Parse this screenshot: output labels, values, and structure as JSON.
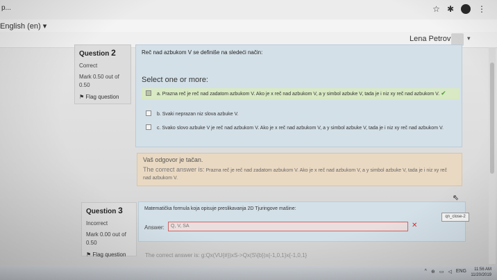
{
  "browser": {
    "tab_fragment": "p...",
    "icons": [
      "star-icon",
      "extension-icon",
      "profile-icon",
      "menu-icon"
    ]
  },
  "nav": {
    "language": "English (en)"
  },
  "user": {
    "name": "Lena Petrovic"
  },
  "question2": {
    "label": "Question",
    "number": "2",
    "state": "Correct",
    "mark_line1": "Mark 0.50 out of",
    "mark_line2": "0.50",
    "flag": "Flag question",
    "text": "Reč nad azbukom V se definiše na sledeći način:",
    "prompt": "Select one or more:",
    "options": [
      {
        "letter": "a.",
        "text": "Prazna reč je reč nad zadatom azbukom V. Ako je x reč nad azbukom V, a y simbol azbuke V, tada je i niz xy reč nad azbukom V.",
        "checked": true
      },
      {
        "letter": "b.",
        "text": "Svaki neprazan niz slova azbuke V.",
        "checked": false
      },
      {
        "letter": "c.",
        "text": "Svako slovo azbuke V je reč nad azbukom V. Ako je x reč nad azbukom V, a y simbol azbuke V, tada je i niz xy reč nad azbukom V.",
        "checked": false
      }
    ],
    "feedback": "Vaš odgovor je tačan.",
    "correct_answer_label": "The correct answer is:",
    "correct_answer": "Prazna reč je reč nad zadatom azbukom V. Ako je x reč nad azbukom V, a y simbol azbuke V, tada je i niz xy reč nad azbukom V."
  },
  "question3": {
    "label": "Question",
    "number": "3",
    "state": "Incorrect",
    "mark_line1": "Mark 0.00 out of",
    "mark_line2": "0.50",
    "flag": "Flag question",
    "text": "Matematička formula koja opisuje preslikavanja 2D Tjuringove mašine:",
    "answer_label": "Answer:",
    "answer_value": "Q, V, SA",
    "correct_answer": "The correct answer is: g:Qx(VU{#})xS->Qx(S\\{b})x{-1,0,1}x{-1,0,1}"
  },
  "tooltip": "qn_close-2",
  "taskbar": {
    "tray": [
      "^",
      "⊕",
      "▭",
      "◁",
      "ENG"
    ],
    "time": "11:56 AM",
    "date": "11/20/2019"
  }
}
